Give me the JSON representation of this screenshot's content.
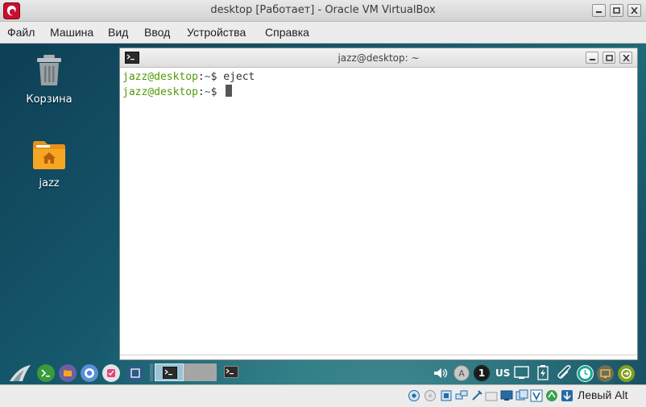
{
  "window": {
    "title": "desktop [Работает] - Oracle VM VirtualBox"
  },
  "menubar": {
    "items": [
      "Файл",
      "Машина",
      "Вид",
      "Ввод",
      "Устройства",
      "Справка"
    ]
  },
  "desktop_icons": [
    {
      "label": "Корзина",
      "icon": "trash-icon"
    },
    {
      "label": "jazz",
      "icon": "home-folder-icon"
    }
  ],
  "terminal": {
    "title": "jazz@desktop: ~",
    "lines": [
      {
        "user": "jazz@desktop",
        "sep": ":",
        "path": "~",
        "dollar": "$ ",
        "command": "eject"
      },
      {
        "user": "jazz@desktop",
        "sep": ":",
        "path": "~",
        "dollar": "$ ",
        "command": ""
      }
    ]
  },
  "taskbar": {
    "tray": {
      "keyboard_layout": "US",
      "workspace_number": "1"
    }
  },
  "statusbar": {
    "host_key": "Левый Alt"
  },
  "colors": {
    "prompt_user": "#4e9a06",
    "prompt_path": "#3465a4",
    "desktop_bg": "#15566a",
    "folder": "#f6a623"
  }
}
